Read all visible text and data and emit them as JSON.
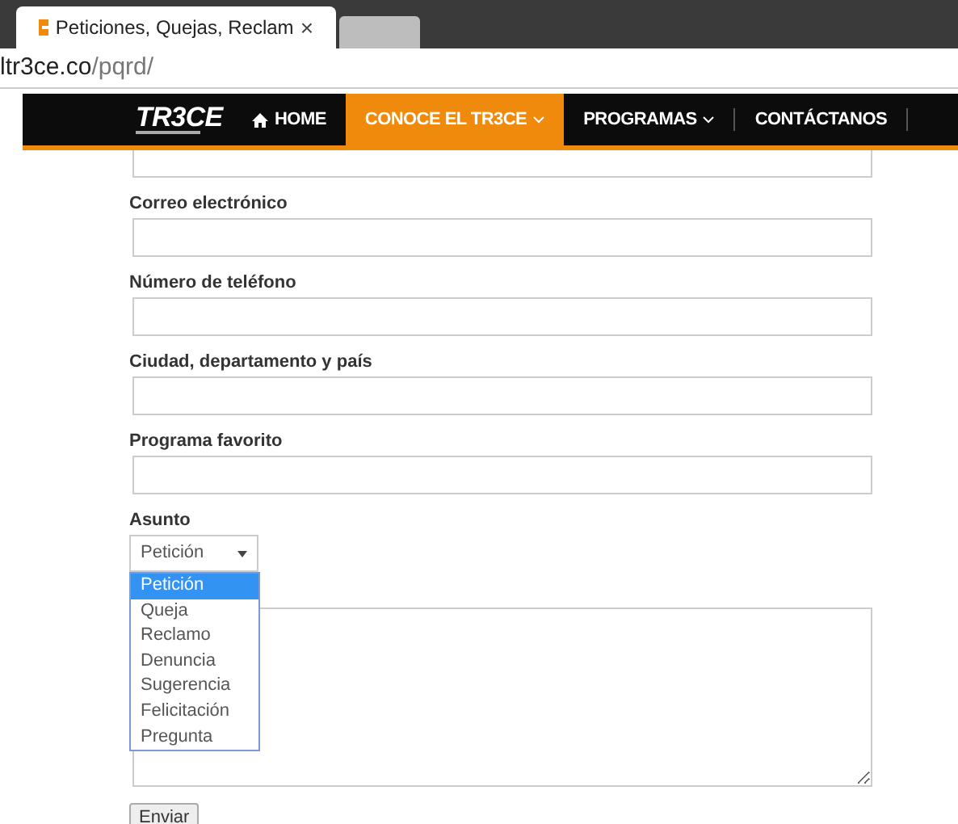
{
  "browser": {
    "tab_title": "Peticiones, Quejas, Reclam",
    "tab_close": "×",
    "url_host": "ltr3ce.co",
    "url_path": "/pqrd/"
  },
  "nav": {
    "logo": "TR3CE",
    "items": [
      {
        "label": "HOME",
        "selected": false,
        "kind": "home"
      },
      {
        "label": "CONOCE EL TR3CE",
        "selected": true,
        "kind": "dropdown"
      },
      {
        "label": "PROGRAMAS",
        "selected": false,
        "kind": "dropdown"
      },
      {
        "label": "CONTÁCTANOS",
        "selected": false,
        "kind": "plain"
      }
    ]
  },
  "form": {
    "fields": [
      {
        "label": "Correo electrónico"
      },
      {
        "label": "Número de teléfono"
      },
      {
        "label": "Ciudad, departamento y país"
      },
      {
        "label": "Programa favorito"
      }
    ],
    "subject": {
      "label": "Asunto",
      "value": "Petición",
      "expanded": true,
      "options": [
        {
          "label": "Petición",
          "selected": true
        },
        {
          "label": "Queja",
          "selected": false
        },
        {
          "label": "Reclamo",
          "selected": false
        },
        {
          "label": "Denuncia",
          "selected": false
        },
        {
          "label": "Sugerencia",
          "selected": false
        },
        {
          "label": "Felicitación",
          "selected": false
        },
        {
          "label": "Pregunta",
          "selected": false
        }
      ]
    },
    "submit": "Enviar"
  }
}
